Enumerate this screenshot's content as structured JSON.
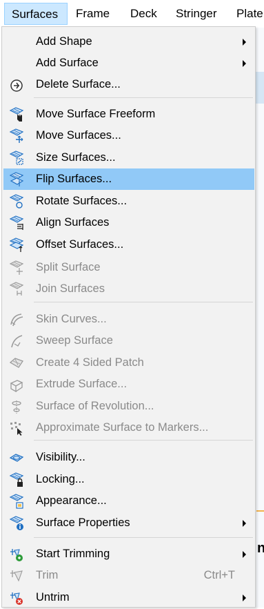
{
  "menubar": {
    "items": [
      "Surfaces",
      "Frame",
      "Deck",
      "Stringer",
      "Plate"
    ],
    "active_index": 0
  },
  "background": {
    "partial_text": "n"
  },
  "menu": {
    "items": [
      {
        "label": "Add Shape",
        "submenu": true,
        "enabled": true,
        "icon": "none"
      },
      {
        "label": "Add Surface",
        "submenu": true,
        "enabled": true,
        "icon": "none"
      },
      {
        "label": "Delete Surface...",
        "enabled": true,
        "icon": "delete-surface-icon"
      },
      {
        "label": "Move Surface Freeform",
        "enabled": true,
        "icon": "move-freeform-icon"
      },
      {
        "label": "Move Surfaces...",
        "enabled": true,
        "icon": "move-surfaces-icon"
      },
      {
        "label": "Size Surfaces...",
        "enabled": true,
        "icon": "size-surfaces-icon"
      },
      {
        "label": "Flip Surfaces...",
        "enabled": true,
        "highlighted": true,
        "icon": "flip-surfaces-icon"
      },
      {
        "label": "Rotate Surfaces...",
        "enabled": true,
        "icon": "rotate-surfaces-icon"
      },
      {
        "label": "Align Surfaces",
        "enabled": true,
        "icon": "align-surfaces-icon"
      },
      {
        "label": "Offset Surfaces...",
        "enabled": true,
        "icon": "offset-surfaces-icon"
      },
      {
        "label": "Split Surface",
        "enabled": false,
        "icon": "split-surface-icon"
      },
      {
        "label": "Join Surfaces",
        "enabled": false,
        "icon": "join-surfaces-icon"
      },
      {
        "label": "Skin Curves...",
        "enabled": false,
        "icon": "skin-curves-icon"
      },
      {
        "label": "Sweep Surface",
        "enabled": false,
        "icon": "sweep-surface-icon"
      },
      {
        "label": "Create 4 Sided Patch",
        "enabled": false,
        "icon": "four-sided-patch-icon"
      },
      {
        "label": "Extrude Surface...",
        "enabled": false,
        "icon": "extrude-surface-icon"
      },
      {
        "label": "Surface of Revolution...",
        "enabled": false,
        "icon": "surface-revolution-icon"
      },
      {
        "label": "Approximate Surface to Markers...",
        "enabled": false,
        "icon": "approximate-markers-icon"
      },
      {
        "label": "Visibility...",
        "enabled": true,
        "icon": "visibility-icon"
      },
      {
        "label": "Locking...",
        "enabled": true,
        "icon": "locking-icon"
      },
      {
        "label": "Appearance...",
        "enabled": true,
        "icon": "appearance-icon"
      },
      {
        "label": "Surface Properties",
        "submenu": true,
        "enabled": true,
        "icon": "surface-properties-icon"
      },
      {
        "label": "Start Trimming",
        "submenu": true,
        "enabled": true,
        "icon": "start-trimming-icon"
      },
      {
        "label": "Trim",
        "enabled": false,
        "shortcut": "Ctrl+T",
        "icon": "trim-icon"
      },
      {
        "label": "Untrim",
        "submenu": true,
        "enabled": true,
        "icon": "untrim-icon"
      }
    ]
  },
  "colors": {
    "menu_bg": "#f2f2f2",
    "highlight": "#91c9f7",
    "menubar_active": "#cce8ff",
    "icon_blue": "#1f6fc2",
    "disabled_text": "#8a8a8a"
  }
}
